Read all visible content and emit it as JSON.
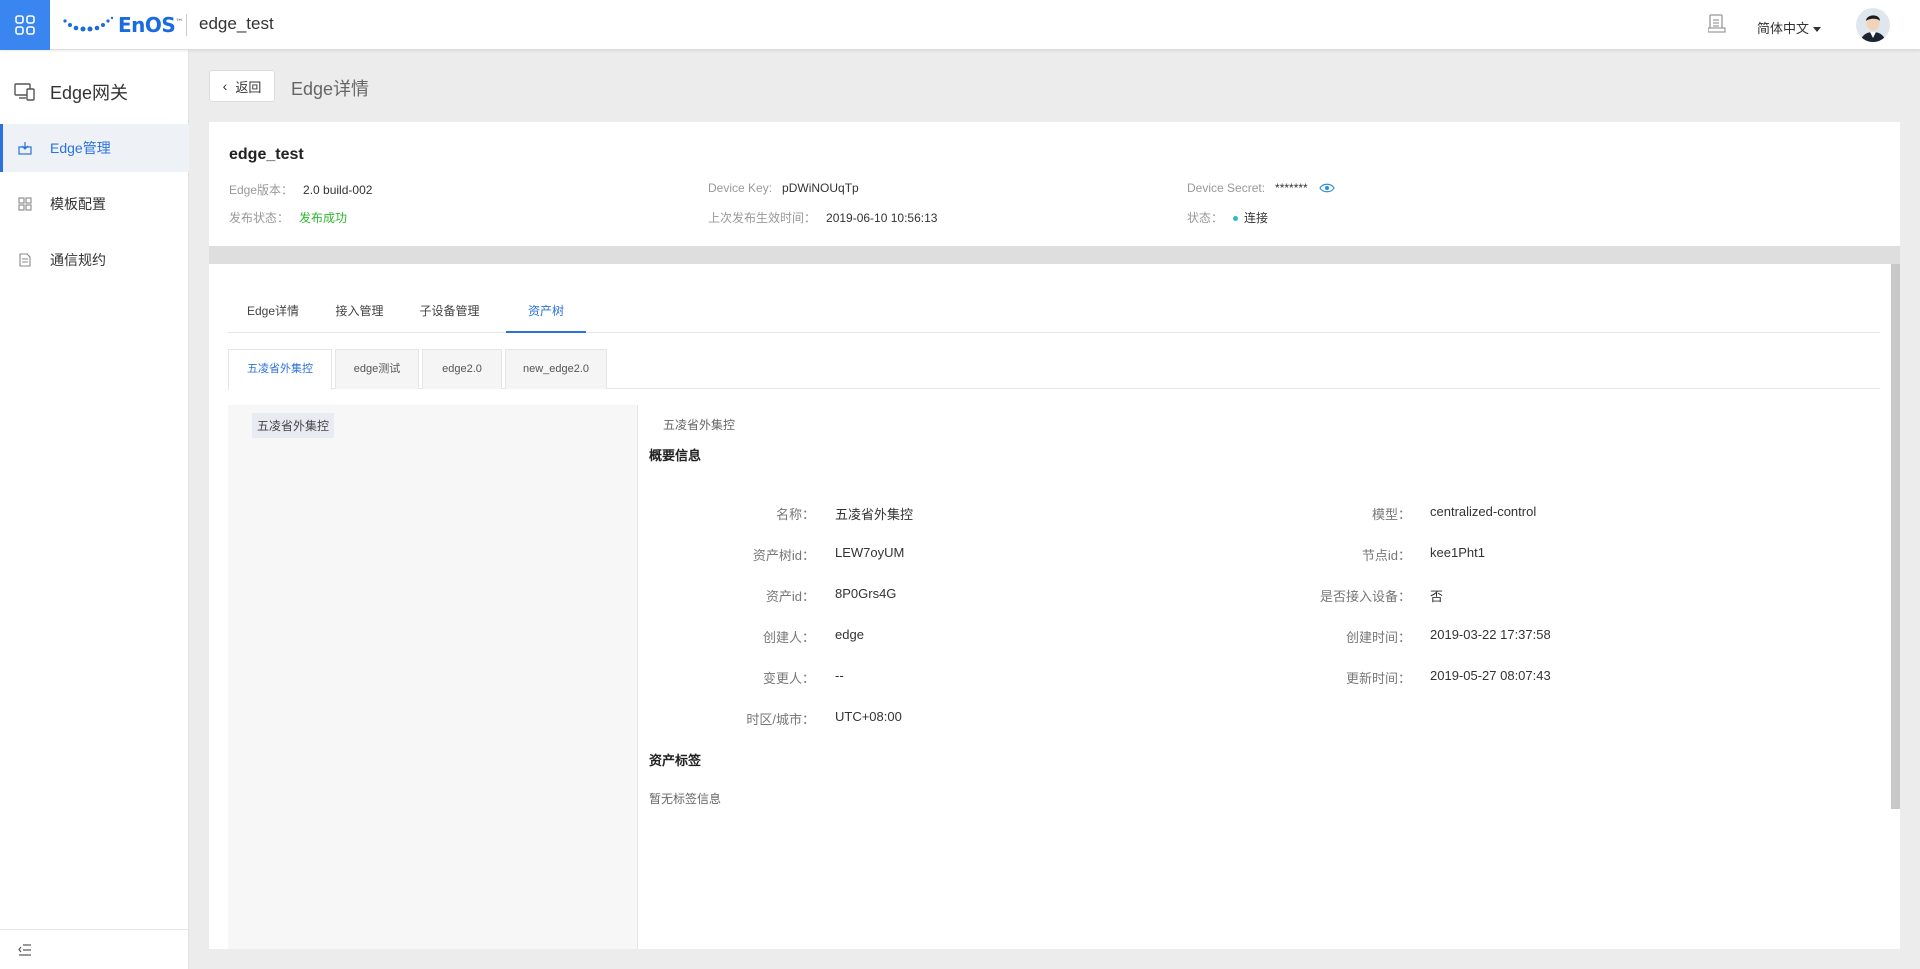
{
  "header": {
    "logo_text": "EnOS",
    "logo_tm": "™",
    "app_name": "edge_test",
    "language": "简体中文",
    "icons": [
      "apps-grid-icon",
      "document-icon",
      "user-avatar"
    ]
  },
  "sidebar": {
    "title": "Edge网关",
    "items": [
      {
        "label": "Edge管理",
        "icon": "download-box-icon",
        "active": true
      },
      {
        "label": "模板配置",
        "icon": "template-grid-icon",
        "active": false
      },
      {
        "label": "通信规约",
        "icon": "protocol-doc-icon",
        "active": false
      }
    ],
    "collapse_icon": "collapse-menu-icon"
  },
  "page": {
    "back_label": "返回",
    "title": "Edge详情"
  },
  "device": {
    "name": "edge_test",
    "version_label": "Edge版本：",
    "version": "2.0 build-002",
    "publish_label": "发布状态：",
    "publish_status": "发布成功",
    "device_key_label": "Device Key:",
    "device_key": "pDWiNOUqTp",
    "last_publish_label": "上次发布生效时间：",
    "last_publish": "2019-06-10 10:56:13",
    "device_secret_label": "Device Secret:",
    "device_secret": "*******",
    "state_label": "状态：",
    "state": "连接"
  },
  "tabs": [
    "Edge详情",
    "接入管理",
    "子设备管理",
    "资产树"
  ],
  "active_tab": "资产树",
  "subtabs": [
    "五凌省外集控",
    "edge测试",
    "edge2.0",
    "new_edge2.0"
  ],
  "tree": {
    "root": "五凌省外集控"
  },
  "detail": {
    "crumb": "五凌省外集控",
    "summary_title": "概要信息",
    "left_fields": [
      {
        "key": "名称：",
        "value": "五凌省外集控"
      },
      {
        "key": "资产树id：",
        "value": "LEW7oyUM"
      },
      {
        "key": "资产id：",
        "value": "8P0Grs4G"
      },
      {
        "key": "创建人：",
        "value": "edge"
      },
      {
        "key": "变更人：",
        "value": "--"
      },
      {
        "key": "时区/城市：",
        "value": "UTC+08:00"
      }
    ],
    "right_fields": [
      {
        "key": "模型：",
        "value": "centralized-control"
      },
      {
        "key": "节点id：",
        "value": "kee1Pht1"
      },
      {
        "key": "是否接入设备：",
        "value": "否"
      },
      {
        "key": "创建时间：",
        "value": "2019-03-22 17:37:58"
      },
      {
        "key": "更新时间：",
        "value": "2019-05-27 08:07:43"
      }
    ],
    "tags_title": "资产标签",
    "no_tags": "暂无标签信息"
  },
  "colors": {
    "primary": "#2b72e0",
    "app_grid_bg": "#3a86f0",
    "success": "#2fb82f",
    "status_dot": "#2fb8c8"
  }
}
